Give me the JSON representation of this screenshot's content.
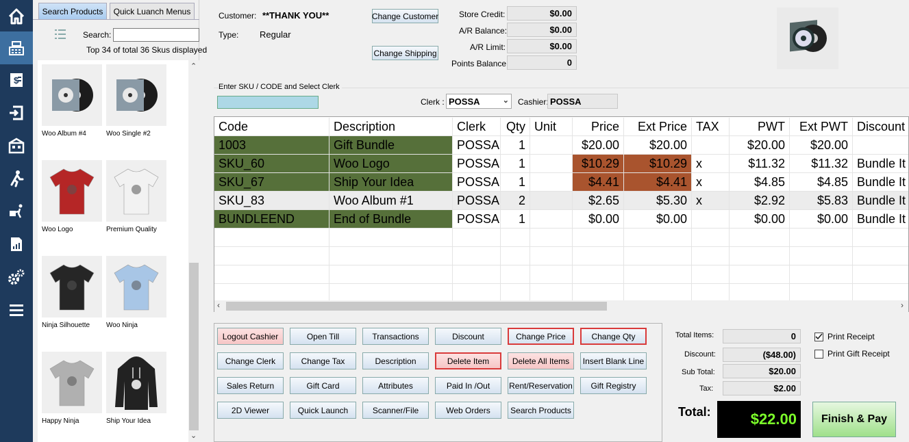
{
  "nav": {
    "items": [
      {
        "icon": "home-icon"
      },
      {
        "icon": "register-icon"
      },
      {
        "icon": "invoice-icon"
      },
      {
        "icon": "exit-icon"
      },
      {
        "icon": "warehouse-icon"
      },
      {
        "icon": "walking-person-icon"
      },
      {
        "icon": "delivery-icon"
      },
      {
        "icon": "report-icon"
      },
      {
        "icon": "settings-icon"
      },
      {
        "icon": "menu-icon"
      }
    ],
    "active_index": 1,
    "colors": {
      "background": "#1e3a5c",
      "active": "#3d6fa0"
    }
  },
  "left": {
    "tabs": [
      "Search Products",
      "Quick Luanch Menus"
    ],
    "search_label": "Search:",
    "search_value": "",
    "count_text": "Top 34 of total 36 Skus displayed",
    "products": [
      {
        "name": "Woo Album #4",
        "icon": "album-icon"
      },
      {
        "name": "Woo Single #2",
        "icon": "album-icon"
      },
      {
        "name": "Woo Logo",
        "icon": "tshirt-icon",
        "color": "#b52626"
      },
      {
        "name": "Premium Quality",
        "icon": "tshirt-icon",
        "color": "#f2f2f2"
      },
      {
        "name": "Ninja Silhouette",
        "icon": "tshirt-icon",
        "color": "#262626"
      },
      {
        "name": "Woo Ninja",
        "icon": "tshirt-icon",
        "color": "#a8c6e6"
      },
      {
        "name": "Happy Ninja",
        "icon": "tshirt-icon",
        "color": "#b0b0b0"
      },
      {
        "name": "Ship Your Idea",
        "icon": "hoodie-icon",
        "color": "#222222"
      }
    ]
  },
  "customer": {
    "customer_label": "Customer:",
    "customer_value": "**THANK YOU**",
    "type_label": "Type:",
    "type_value": "Regular",
    "change_customer": "Change Customer",
    "change_shipping": "Change Shipping",
    "store_credit_label": "Store Credit:",
    "store_credit": "$0.00",
    "ar_balance_label": "A/R Balance:",
    "ar_balance": "$0.00",
    "ar_limit_label": "A/R Limit:",
    "ar_limit": "$0.00",
    "points_label": "Points Balance:",
    "points": "0"
  },
  "sku": {
    "label": "Enter SKU / CODE and Select Clerk",
    "value": "",
    "clerk_label": "Clerk :",
    "clerk_value": "POSSA",
    "cashier_label": "Cashier:",
    "cashier_value": "POSSA"
  },
  "grid": {
    "headers": [
      "Code",
      "Description",
      "Clerk",
      "Qty",
      "Unit",
      "Price",
      "Ext Price",
      "TAX",
      "PWT",
      "Ext PWT",
      "Discount"
    ],
    "rows": [
      {
        "code": "1003",
        "description": "Gift Bundle",
        "clerk": "POSSA",
        "qty": "1",
        "unit": "",
        "price": "$20.00",
        "ext_price": "$20.00",
        "tax": "",
        "pwt": "$20.00",
        "ext_pwt": "$20.00",
        "discount": ""
      },
      {
        "code": "SKU_60",
        "description": "Woo Logo",
        "clerk": "POSSA",
        "qty": "1",
        "unit": "",
        "price": "$10.29",
        "ext_price": "$10.29",
        "tax": "x",
        "pwt": "$11.32",
        "ext_pwt": "$11.32",
        "discount": "Bundle It"
      },
      {
        "code": "SKU_67",
        "description": "Ship Your Idea",
        "clerk": "POSSA",
        "qty": "1",
        "unit": "",
        "price": "$4.41",
        "ext_price": "$4.41",
        "tax": "x",
        "pwt": "$4.85",
        "ext_pwt": "$4.85",
        "discount": "Bundle It"
      },
      {
        "code": "SKU_83",
        "description": "Woo Album #1",
        "clerk": "POSSA",
        "qty": "2",
        "unit": "",
        "price": "$2.65",
        "ext_price": "$5.30",
        "tax": "x",
        "pwt": "$2.92",
        "ext_pwt": "$5.83",
        "discount": "Bundle It"
      },
      {
        "code": "BUNDLEEND",
        "description": "End of Bundle",
        "clerk": "POSSA",
        "qty": "1",
        "unit": "",
        "price": "$0.00",
        "ext_price": "$0.00",
        "tax": "",
        "pwt": "$0.00",
        "ext_pwt": "$0.00",
        "discount": "Bundle It"
      }
    ],
    "colors": {
      "bundle_green": "#56703a",
      "price_orange": "#a9542e"
    }
  },
  "actions": [
    "Logout Cashier",
    "Open Till",
    "Transactions",
    "Discount",
    "Change Price",
    "Change Qty",
    "Change Clerk",
    "Change Tax",
    "Description",
    "Delete Item",
    "Delete All Items",
    "Insert Blank Line",
    "Sales Return",
    "Gift Card",
    "Attributes",
    "Paid In /Out",
    "Rent/Reservation",
    "Gift Registry",
    "2D Viewer",
    "Quick Launch",
    "Scanner/File",
    "Web Orders",
    "Search Products"
  ],
  "totals": {
    "total_items_label": "Total Items:",
    "total_items": "0",
    "discount_label": "Discount:",
    "discount": "($48.00)",
    "subtotal_label": "Sub Total:",
    "subtotal": "$20.00",
    "tax_label": "Tax:",
    "tax": "$2.00",
    "total_label": "Total:",
    "total": "$22.00",
    "finish_label": "Finish & Pay",
    "print_receipt": "Print Receipt",
    "print_receipt_checked": true,
    "print_gift_receipt": "Print Gift Receipt",
    "print_gift_receipt_checked": false,
    "total_color": "#7cff2a"
  }
}
